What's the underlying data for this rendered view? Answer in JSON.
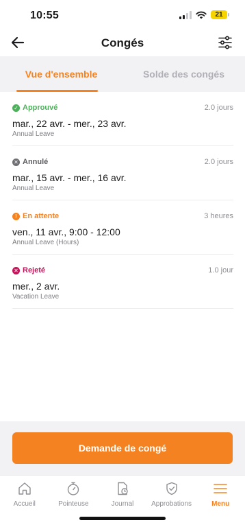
{
  "status_bar": {
    "time": "10:55",
    "battery": "21"
  },
  "nav": {
    "title": "Congés"
  },
  "tabs": [
    {
      "label": "Vue d'ensemble",
      "active": true
    },
    {
      "label": "Solde des congés",
      "active": false
    }
  ],
  "leaves": [
    {
      "status": "Approuvé",
      "status_icon": "check-circle-icon",
      "duration": "2.0 jours",
      "dates": "mar., 22 avr. - mer., 23 avr.",
      "type": "Annual Leave"
    },
    {
      "status": "Annulé",
      "status_icon": "x-circle-icon",
      "duration": "2.0 jours",
      "dates": "mar., 15 avr. - mer., 16 avr.",
      "type": "Annual Leave"
    },
    {
      "status": "En attente",
      "status_icon": "exclamation-circle-icon",
      "duration": "3 heures",
      "dates": "ven., 11 avr., 9:00 - 12:00",
      "type": "Annual Leave (Hours)"
    },
    {
      "status": "Rejeté",
      "status_icon": "x-circle-icon",
      "duration": "1.0 jour",
      "dates": "mer., 2 avr.",
      "type": "Vacation Leave"
    }
  ],
  "action": {
    "request_label": "Demande de congé"
  },
  "bottom_nav": [
    {
      "label": "Accueil",
      "icon": "home-icon"
    },
    {
      "label": "Pointeuse",
      "icon": "stopwatch-icon"
    },
    {
      "label": "Journal",
      "icon": "journal-icon"
    },
    {
      "label": "Approbations",
      "icon": "shield-check-icon"
    },
    {
      "label": "Menu",
      "icon": "menu-icon",
      "active": true
    }
  ],
  "colors": {
    "accent": "#f58220",
    "approved": "#4cb15a",
    "cancelled": "#6e6e73",
    "rejected": "#c2185b"
  }
}
